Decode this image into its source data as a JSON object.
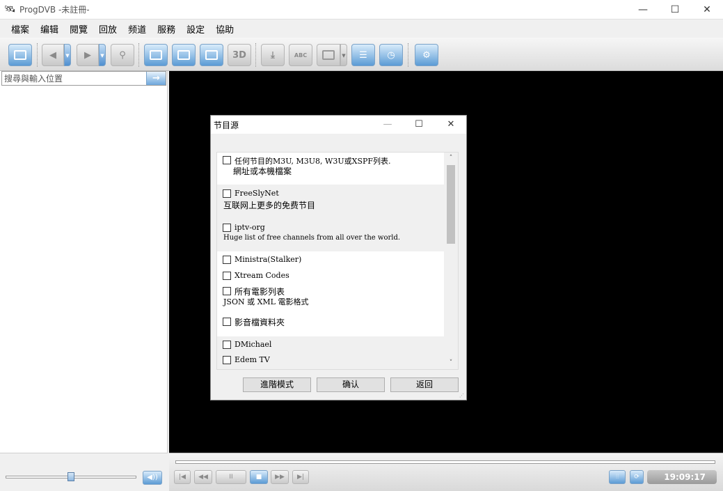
{
  "window": {
    "title": "ProgDVB -未註冊-",
    "controls": {
      "minimize": "—",
      "maximize": "☐",
      "close": "✕"
    }
  },
  "menu": [
    "檔案",
    "编辑",
    "閱覽",
    "回放",
    "频道",
    "服務",
    "設定",
    "協助"
  ],
  "toolbar": {
    "buttons": [
      "channel-list",
      "back",
      "forward",
      "search",
      "window-mode",
      "fullscreen",
      "mosaic",
      "3d",
      "record",
      "subtitle",
      "teletext",
      "epg-list",
      "scheduler",
      "settings"
    ],
    "label_3d": "3D",
    "label_sub": "ABC"
  },
  "search": {
    "placeholder": "搜尋與輸入位置",
    "go": "→"
  },
  "dialog": {
    "title": "节目源",
    "controls": {
      "minimize": "—",
      "maximize": "☐",
      "close": "✕"
    },
    "items": [
      {
        "label": "任何节目的M3U, M3U8, W3U或XSPF列表.",
        "desc": "網址或本機檔案",
        "checked": false
      },
      {
        "label": "FreeSlyNet",
        "desc": "互联网上更多的免费节目",
        "checked": false
      },
      {
        "label": "iptv-org",
        "desc": "Huge list of free channels from all over the world.",
        "checked": false
      },
      {
        "label": "Ministra(Stalker)",
        "desc": "",
        "checked": false
      },
      {
        "label": "Xtream Codes",
        "desc": "",
        "checked": false
      },
      {
        "label": "所有電影列表",
        "desc": "JSON 或 XML 電影格式",
        "checked": false
      },
      {
        "label": "影音檔資料夾",
        "desc": "",
        "checked": false
      },
      {
        "label": "DMichael",
        "desc": "",
        "checked": false
      },
      {
        "label": "Edem TV",
        "desc": "",
        "checked": false
      }
    ],
    "scroll": {
      "up": "˄",
      "down": "˅"
    },
    "buttons": {
      "advanced": "進階模式",
      "ok": "确认",
      "back": "返回"
    },
    "grip": "⋰"
  },
  "player": {
    "time": "19:09:17",
    "controls": [
      "prev",
      "rewind",
      "pause",
      "stop",
      "forward",
      "next"
    ],
    "glyphs": {
      "prev": "|◀",
      "rewind": "◀◀",
      "pause": "II",
      "stop": "■",
      "forward": "▶▶",
      "next": "▶|",
      "volume": "◀))",
      "eq": "⫶⫶",
      "refresh": "⟳"
    }
  },
  "icons": {
    "app": "🛰"
  }
}
